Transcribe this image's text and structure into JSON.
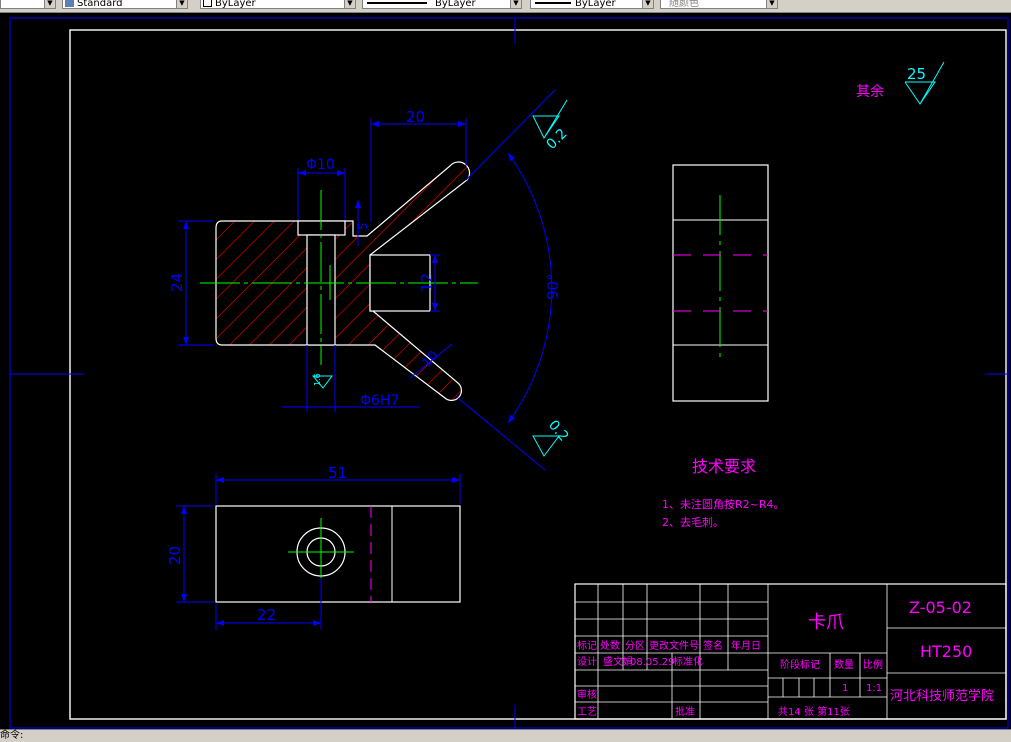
{
  "toolbar": {
    "style_combo": "Standard",
    "layer_combo": "ByLayer",
    "linetype_combo": "ByLayer",
    "lineweight_combo": "ByLayer",
    "color_combo": "随颜色"
  },
  "drawing": {
    "roughness": {
      "label": "其余",
      "value": "25"
    },
    "dims_front": {
      "width_top": "20",
      "hole_dia": "Φ10",
      "height_left": "24",
      "slot_height": "12",
      "bottom_dim": "Φ6H7",
      "small_dim": "5",
      "angle": "90°",
      "rough_top": "0.2",
      "rough_bottom": "0.2",
      "rough_small": "1.6",
      "arm_width": "10"
    },
    "dims_top": {
      "width": "51",
      "height": "20",
      "hole_pos": "22"
    },
    "tech_req": {
      "title": "技术要求",
      "items": [
        "1、未注圆角按R2~R4。",
        "2、去毛刺。"
      ]
    },
    "title_block": {
      "part_name": "卡爪",
      "drawing_no": "Z-05-02",
      "material": "HT250",
      "school": "河北科技师范学院",
      "sheets": "共14 张  第11张",
      "scale_label": "比例",
      "scale": "1:1",
      "qty_label": "数量",
      "qty": "1",
      "stage_label": "阶段标记",
      "hdr": [
        "标记",
        "处数",
        "分区",
        "更改文件号",
        "签名",
        "年月日"
      ],
      "design_label": "设计",
      "designer": "盛文娟",
      "design_date": "08.05.29",
      "std_label": "标准化",
      "review_label": "审核",
      "process_label": "工艺",
      "approve_label": "批准"
    }
  },
  "status": {
    "text": "命令:"
  },
  "colors": {
    "outline": "#ffffff",
    "dim": "#0000ff",
    "text_dim": "#0000ff",
    "center": "#00ff00",
    "hatch": "#ff0000",
    "annot": "#ff00ff",
    "rough": "#00ffff"
  }
}
